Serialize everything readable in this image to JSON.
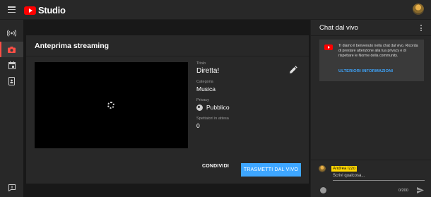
{
  "topbar": {
    "logo_text": "Studio"
  },
  "sidebar": {
    "items": [
      "live-icon",
      "camera-icon",
      "calendar-icon",
      "phone-icon",
      "feedback-icon"
    ]
  },
  "preview": {
    "title": "Anteprima streaming",
    "title_label": "Titolo",
    "title_value": "Diretta!",
    "category_label": "Categoria",
    "category_value": "Musica",
    "privacy_label": "Privacy",
    "privacy_value": "Pubblico",
    "waiting_label": "Spettatori in attesa",
    "waiting_value": "0",
    "share_label": "CONDIVIDI",
    "stream_label": "TRASMETTI DAL VIVO"
  },
  "chat": {
    "title": "Chat dal vivo",
    "welcome_text": "Ti diamo il benvenuto nella chat dal vivo. Ricorda di prestare attenzione alla tua privacy e di rispettare le Norme della community.",
    "welcome_link": "ULTERIORI INFORMAZIONI",
    "author_name": "Andrea Izzo",
    "input_placeholder": "Scrivi qualcosa...",
    "counter": "0/200"
  },
  "colors": {
    "accent": "#3ea6ff",
    "brand": "#ff0000",
    "active": "#ff4e45"
  }
}
